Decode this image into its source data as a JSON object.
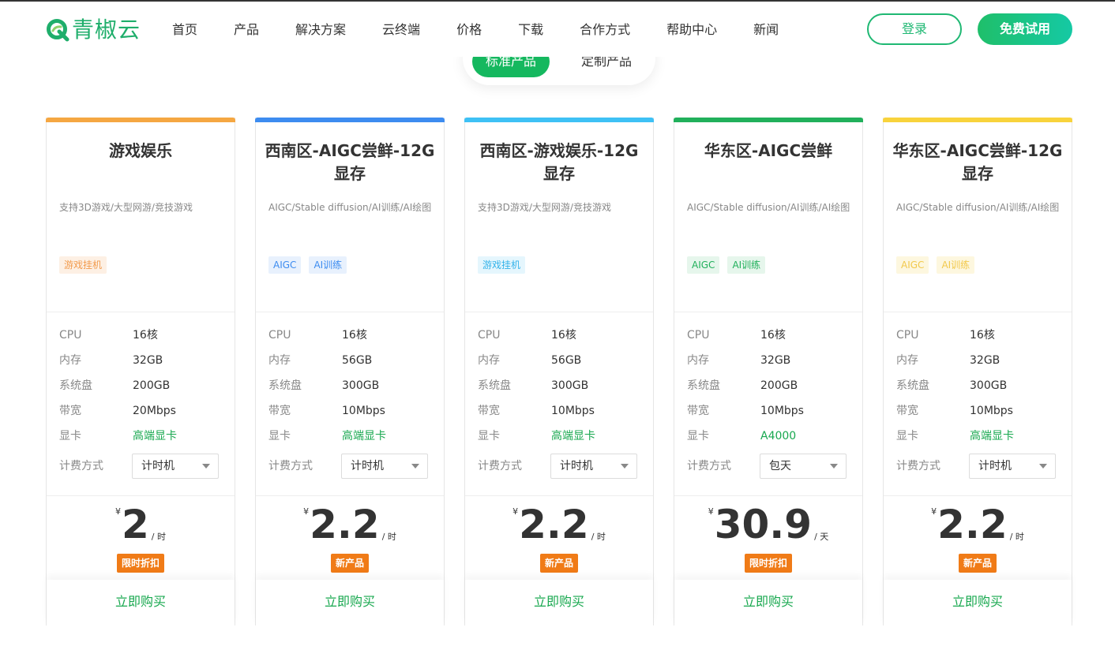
{
  "header": {
    "logo_text": "青椒云",
    "nav": [
      "首页",
      "产品",
      "解决方案",
      "云终端",
      "价格",
      "下载",
      "合作方式",
      "帮助中心",
      "新闻"
    ],
    "login_label": "登录",
    "trial_label": "免费试用"
  },
  "tabs": {
    "active": "标准产品",
    "inactive": "定制产品"
  },
  "spec_labels": {
    "cpu": "CPU",
    "memory": "内存",
    "disk": "系统盘",
    "bandwidth": "带宽",
    "gpu": "显卡",
    "billing": "计费方式"
  },
  "currency_symbol": "¥",
  "buy_label": "立即购买",
  "cards": [
    {
      "title": "游戏娱乐",
      "desc": "支持3D游戏/大型网游/竞技游戏",
      "tags": [
        "游戏挂机"
      ],
      "cpu": "16核",
      "memory": "32GB",
      "disk": "200GB",
      "bandwidth": "20Mbps",
      "gpu": "高端显卡",
      "billing": "计时机",
      "price": "2",
      "unit": "/ 时",
      "badge": "限时折扣",
      "color": "#f5a742"
    },
    {
      "title": "西南区-AIGC尝鲜-12G显存",
      "desc": "AIGC/Stable diffusion/AI训练/AI绘图",
      "tags": [
        "AIGC",
        "AI训练"
      ],
      "cpu": "16核",
      "memory": "56GB",
      "disk": "300GB",
      "bandwidth": "10Mbps",
      "gpu": "高端显卡",
      "billing": "计时机",
      "price": "2.2",
      "unit": "/ 时",
      "badge": "新产品",
      "color": "#3d8cf0"
    },
    {
      "title": "西南区-游戏娱乐-12G显存",
      "desc": "支持3D游戏/大型网游/竞技游戏",
      "tags": [
        "游戏挂机"
      ],
      "cpu": "16核",
      "memory": "56GB",
      "disk": "300GB",
      "bandwidth": "10Mbps",
      "gpu": "高端显卡",
      "billing": "计时机",
      "price": "2.2",
      "unit": "/ 时",
      "badge": "新产品",
      "color": "#3ec1f5"
    },
    {
      "title": "华东区-AIGC尝鲜",
      "desc": "AIGC/Stable diffusion/AI训练/AI绘图",
      "tags": [
        "AIGC",
        "AI训练"
      ],
      "cpu": "16核",
      "memory": "32GB",
      "disk": "200GB",
      "bandwidth": "10Mbps",
      "gpu": "A4000",
      "billing": "包天",
      "price": "30.9",
      "unit": "/ 天",
      "badge": "限时折扣",
      "color": "#21b05b"
    },
    {
      "title": "华东区-AIGC尝鲜-12G显存",
      "desc": "AIGC/Stable diffusion/AI训练/AI绘图",
      "tags": [
        "AIGC",
        "AI训练"
      ],
      "cpu": "16核",
      "memory": "32GB",
      "disk": "300GB",
      "bandwidth": "10Mbps",
      "gpu": "高端显卡",
      "billing": "计时机",
      "price": "2.2",
      "unit": "/ 时",
      "badge": "新产品",
      "color": "#f8d33c"
    }
  ]
}
